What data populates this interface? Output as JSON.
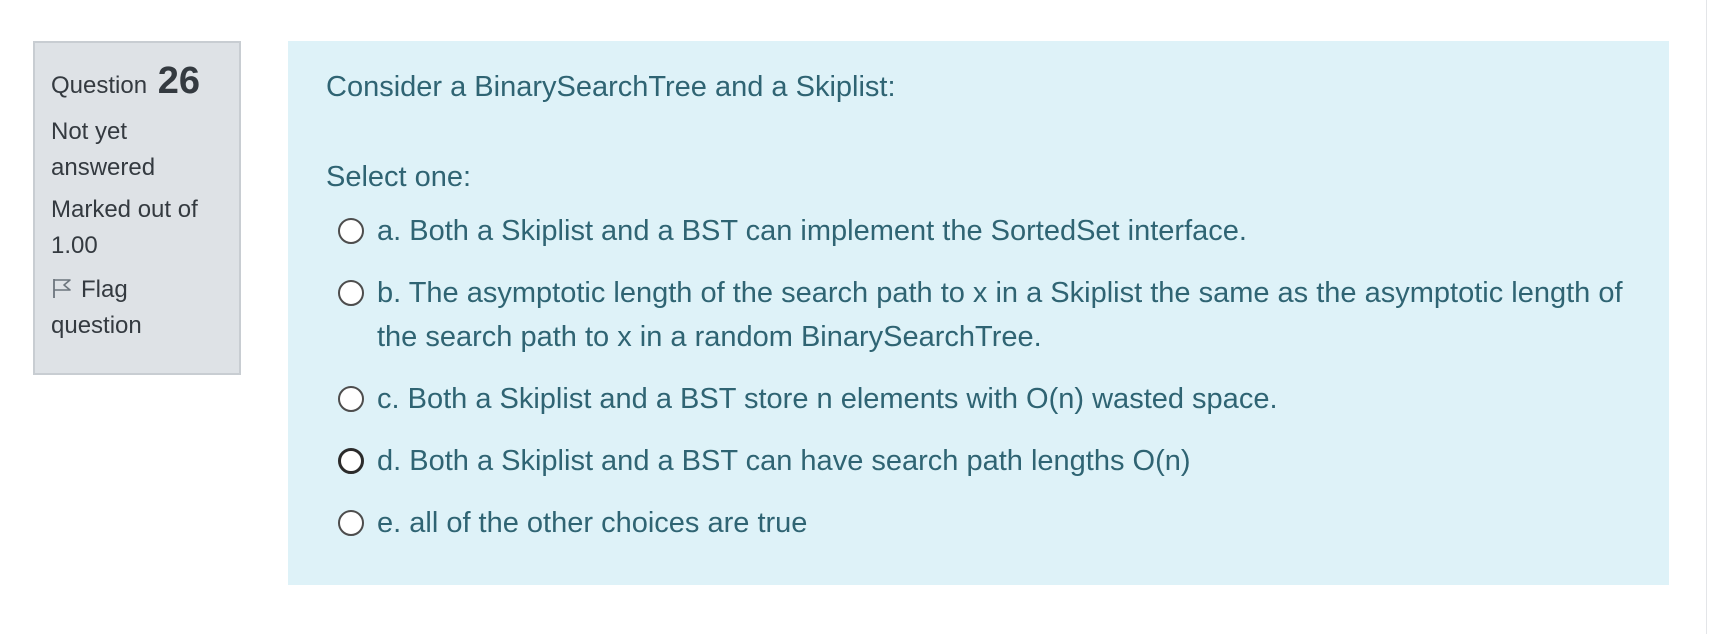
{
  "question_info": {
    "label": "Question",
    "number": "26",
    "state": "Not yet answered",
    "grade": "Marked out of 1.00",
    "flag_label": "Flag question"
  },
  "question": {
    "text": "Consider a BinarySearchTree and a Skiplist:",
    "prompt": "Select one:",
    "answers": [
      {
        "label": "a. Both a Skiplist and a BST can implement the SortedSet interface.",
        "selected": false
      },
      {
        "label": "b. The asymptotic length of the search path to x in a Skiplist the same as the asymptotic length of the search path to x in a random BinarySearchTree.",
        "selected": false
      },
      {
        "label": "c. Both a Skiplist and a BST store n elements with O(n) wasted space.",
        "selected": false
      },
      {
        "label": "d. Both a Skiplist and a BST can have search path lengths O(n)",
        "selected": false
      },
      {
        "label": "e. all of the other choices are true",
        "selected": false
      }
    ]
  },
  "colors": {
    "info_background": "#dee2e6",
    "content_background": "#def2f8",
    "content_text": "#2f6473",
    "info_text": "#343a40"
  },
  "icons": {
    "flag": "flag-icon",
    "radio": "radio-button-icon"
  }
}
